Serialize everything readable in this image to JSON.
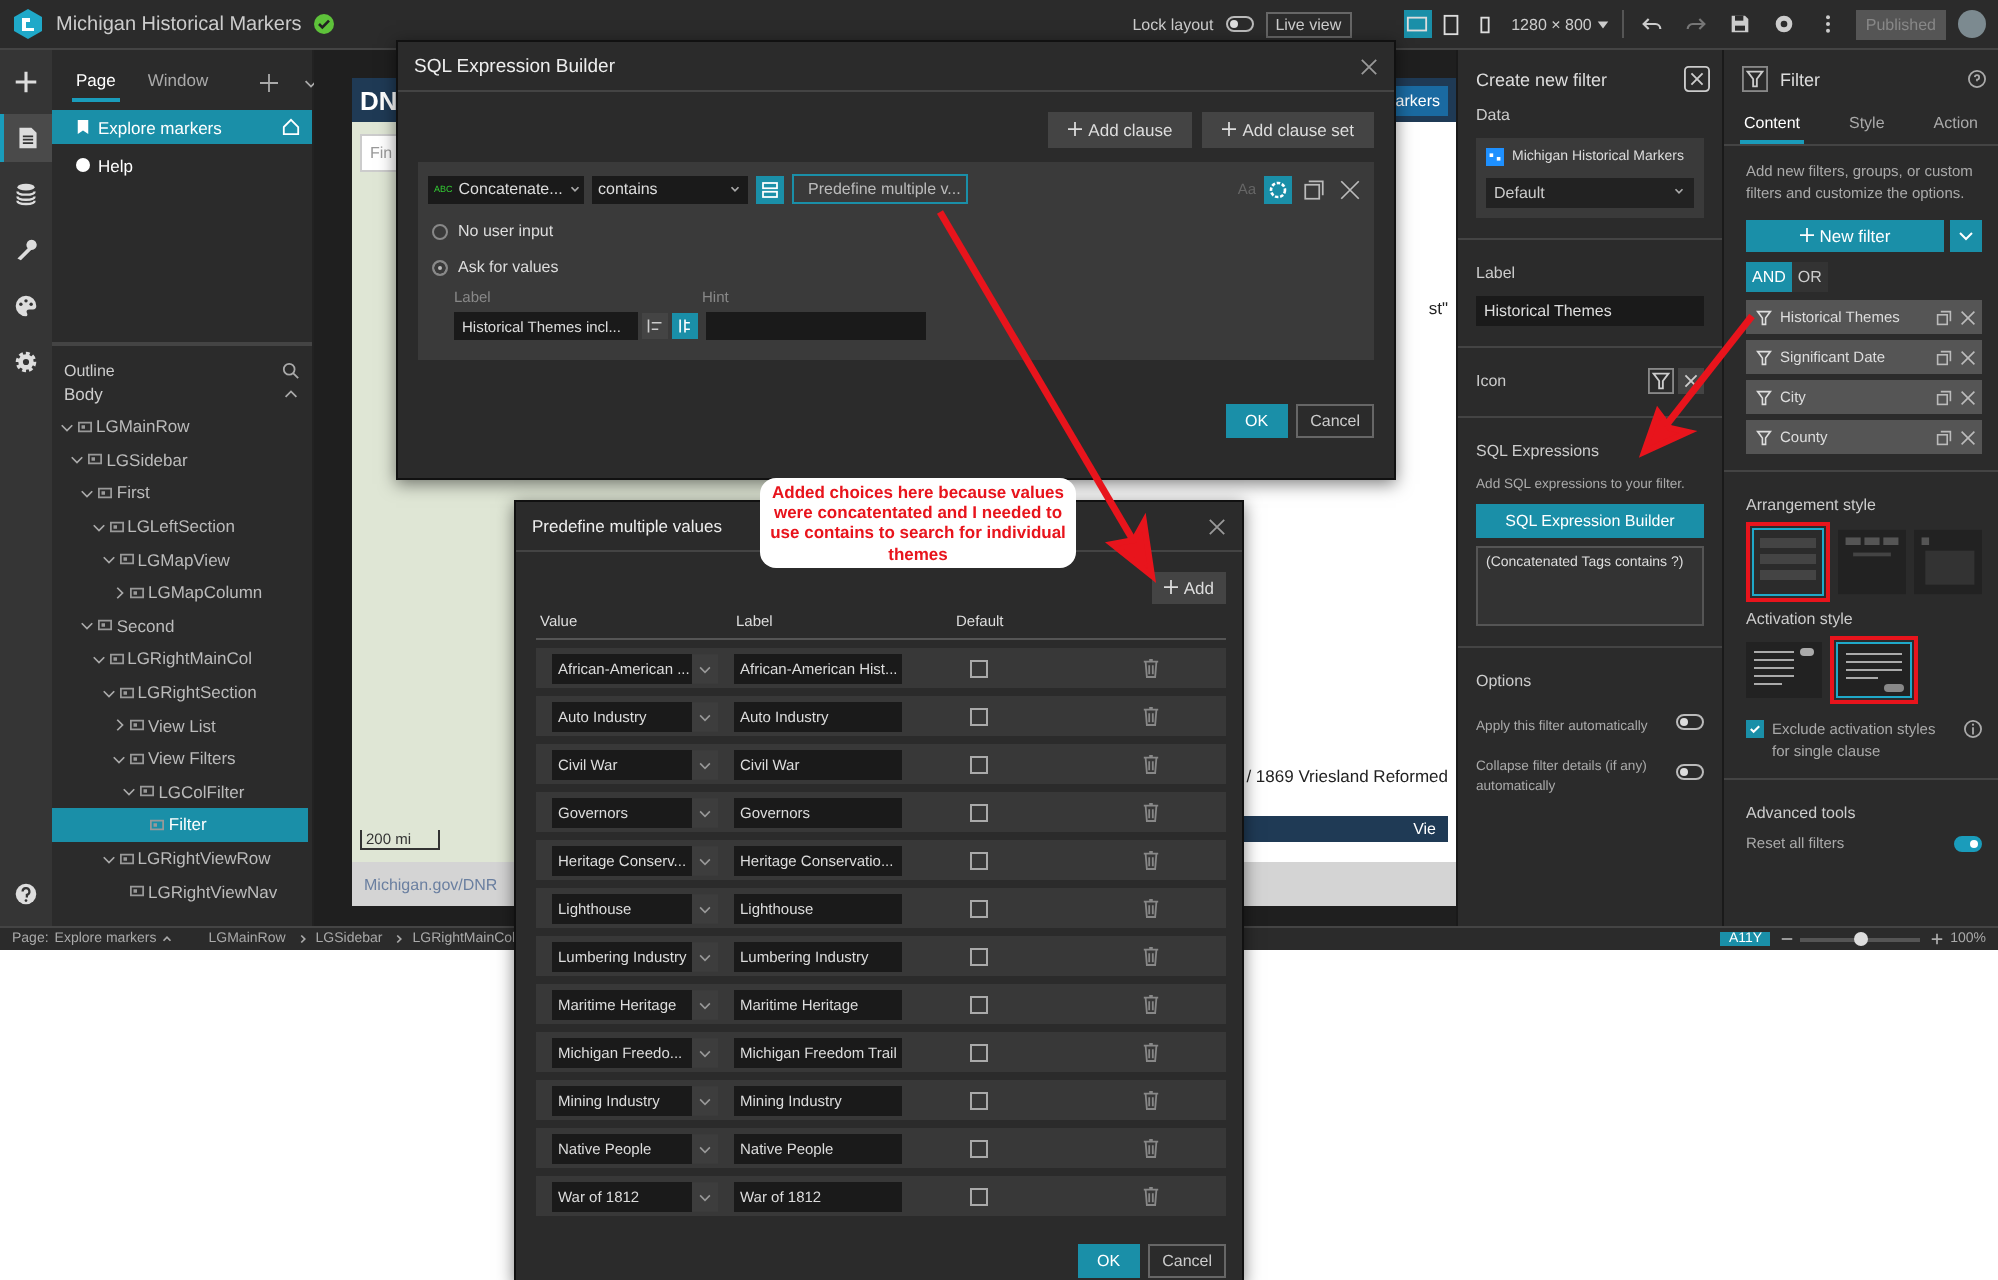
{
  "topbar": {
    "title": "Michigan Historical Markers",
    "lock_layout": {
      "label": "Lock layout",
      "on": false
    },
    "live_view": "Live view",
    "devices": [
      {
        "kind": "desktop",
        "selected": true
      },
      {
        "kind": "tablet",
        "selected": false
      },
      {
        "kind": "phone",
        "selected": false
      }
    ],
    "resolution": "1280 × 800",
    "published": "Published"
  },
  "rail": [
    {
      "kind": "add",
      "selected": false
    },
    {
      "kind": "page",
      "selected": true
    },
    {
      "kind": "data",
      "selected": false
    },
    {
      "kind": "widget",
      "selected": false
    },
    {
      "kind": "theme",
      "selected": false
    },
    {
      "kind": "settings",
      "selected": false
    },
    {
      "kind": "help",
      "selected": false
    }
  ],
  "page_panel": {
    "tabs": [
      {
        "label": "Page",
        "selected": true
      },
      {
        "label": "Window",
        "selected": false
      }
    ],
    "pages": [
      {
        "label": "Explore markers",
        "selected": true,
        "home": true
      },
      {
        "label": "Help",
        "selected": false,
        "home": false
      }
    ]
  },
  "outline": {
    "title": "Outline",
    "section": "Body",
    "tree": [
      {
        "label": "LGMainRow",
        "expanded": true,
        "selected": false,
        "children": [
          {
            "label": "LGSidebar",
            "expanded": true,
            "selected": false,
            "children": [
              {
                "label": "First",
                "expanded": true,
                "selected": false,
                "children": [
                  {
                    "label": "LGLeftSection",
                    "expanded": true,
                    "selected": false,
                    "children": [
                      {
                        "label": "LGMapView",
                        "expanded": true,
                        "selected": false,
                        "children": [
                          {
                            "label": "LGMapColumn",
                            "expanded": false,
                            "selected": false
                          }
                        ]
                      }
                    ]
                  }
                ]
              },
              {
                "label": "Second",
                "expanded": true,
                "selected": false,
                "children": [
                  {
                    "label": "LGRightMainCol",
                    "expanded": true,
                    "selected": false,
                    "children": [
                      {
                        "label": "LGRightSection",
                        "expanded": true,
                        "selected": false,
                        "children": [
                          {
                            "label": "View List",
                            "expanded": false,
                            "selected": false
                          },
                          {
                            "label": "View Filters",
                            "expanded": true,
                            "selected": false,
                            "children": [
                              {
                                "label": "LGColFilter",
                                "expanded": true,
                                "selected": false,
                                "children": [
                                  {
                                    "label": "Filter",
                                    "selected": true
                                  }
                                ]
                              }
                            ]
                          }
                        ]
                      },
                      {
                        "label": "LGRightViewRow",
                        "expanded": true,
                        "selected": false,
                        "children": [
                          {
                            "label": "LGRightViewNav",
                            "selected": false
                          }
                        ]
                      }
                    ]
                  }
                ]
              }
            ]
          }
        ]
      }
    ]
  },
  "preview": {
    "header": "DN",
    "search_placeholder": "Fin",
    "scale": "200 mi",
    "attribution": "Michigan.gov/DNR",
    "header_button": "arkers",
    "list_texts": [
      "st\"",
      "/ 1869 Vriesland Reformed"
    ],
    "nav_button": "Vie"
  },
  "status_bar": {
    "page_label": "Page:",
    "page": "Explore markers",
    "crumbs": [
      "LGMainRow",
      "LGSidebar",
      "LGRightMainCol"
    ],
    "a11y": "A11Y",
    "zoom_slider": {
      "level": 0.5
    },
    "zoom": "100%"
  },
  "create_filter": {
    "title": "Create new filter",
    "data_heading": "Data",
    "data_source": "Michigan Historical Markers",
    "view": "Default",
    "label_heading": "Label",
    "label_value": "Historical Themes",
    "icon_heading": "Icon",
    "sql_heading": "SQL Expressions",
    "sql_description": "Add SQL expressions to your filter.",
    "sql_button": "SQL Expression Builder",
    "sql_text": "(Concatenated Tags contains ?)",
    "options_heading": "Options",
    "options": [
      {
        "label": "Apply this filter automatically",
        "on": false
      },
      {
        "label": "Collapse filter details (if any) automatically",
        "on": false
      }
    ]
  },
  "filter_settings": {
    "title": "Filter",
    "tabs": [
      {
        "label": "Content",
        "selected": true
      },
      {
        "label": "Style",
        "selected": false
      },
      {
        "label": "Action",
        "selected": false
      }
    ],
    "description": "Add new filters, groups, or custom filters and customize the options.",
    "new_filter": "New filter",
    "logic": [
      {
        "label": "AND",
        "selected": true
      },
      {
        "label": "OR",
        "selected": false
      }
    ],
    "filters": [
      "Historical Themes",
      "Significant Date",
      "City",
      "County"
    ],
    "arrangement_heading": "Arrangement style",
    "arrangements": [
      {
        "kind": "block",
        "selected": true
      },
      {
        "kind": "inline",
        "selected": false
      },
      {
        "kind": "popper",
        "selected": false
      }
    ],
    "activation_heading": "Activation style",
    "activations": [
      {
        "kind": "toggle",
        "selected": false
      },
      {
        "kind": "button",
        "selected": true
      }
    ],
    "exclude": {
      "label": "Exclude activation styles for single clause",
      "checked": true
    },
    "advanced_heading": "Advanced tools",
    "reset": {
      "label": "Reset all filters",
      "on": true
    }
  },
  "sql_dialog": {
    "title": "SQL Expression Builder",
    "add_clause": "Add clause",
    "add_clause_set": "Add clause set",
    "field_type": "ABC",
    "field": "Concatenate...",
    "operator": "contains",
    "value": "Predefine multiple v...",
    "case": "Aa",
    "inputs": [
      {
        "label": "No user input",
        "selected": false
      },
      {
        "label": "Ask for values",
        "selected": true
      }
    ],
    "label_heading": "Label",
    "label_value": "Historical Themes incl...",
    "hint_heading": "Hint",
    "ok": "OK",
    "cancel": "Cancel"
  },
  "predefine_dialog": {
    "title": "Predefine multiple values",
    "add": "Add",
    "columns": [
      "Value",
      "Label",
      "Default"
    ],
    "rows": [
      {
        "value": "African-American ...",
        "label": "African-American Hist...",
        "default": false
      },
      {
        "value": "Auto Industry",
        "label": "Auto Industry",
        "default": false
      },
      {
        "value": "Civil War",
        "label": "Civil War",
        "default": false
      },
      {
        "value": "Governors",
        "label": "Governors",
        "default": false
      },
      {
        "value": "Heritage Conserv...",
        "label": "Heritage Conservatio...",
        "default": false
      },
      {
        "value": "Lighthouse",
        "label": "Lighthouse",
        "default": false
      },
      {
        "value": "Lumbering Industry",
        "label": "Lumbering Industry",
        "default": false
      },
      {
        "value": "Maritime Heritage",
        "label": "Maritime Heritage",
        "default": false
      },
      {
        "value": "Michigan Freedo...",
        "label": "Michigan Freedom Trail",
        "default": false
      },
      {
        "value": "Mining Industry",
        "label": "Mining Industry",
        "default": false
      },
      {
        "value": "Native People",
        "label": "Native People",
        "default": false
      },
      {
        "value": "War of 1812",
        "label": "War of 1812",
        "default": false
      }
    ],
    "ok": "OK",
    "cancel": "Cancel"
  },
  "annotation": "Added choices here because values were concatentated and I needed to use contains to search for individual themes"
}
